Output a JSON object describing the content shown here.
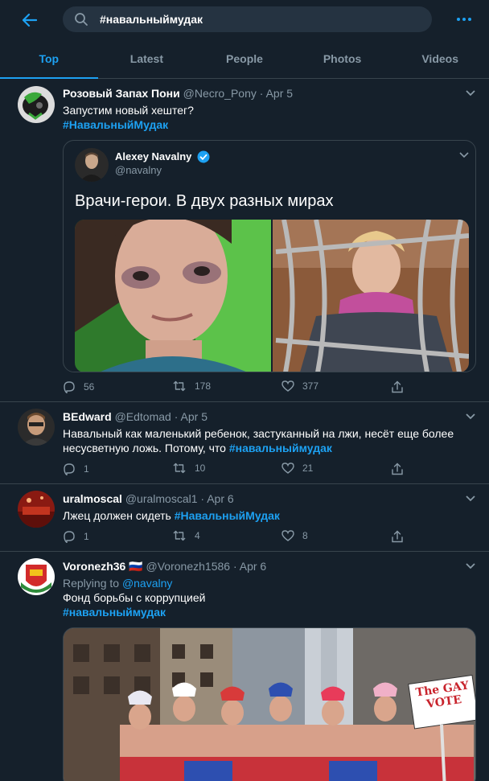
{
  "search": {
    "query": "#навальныймудак"
  },
  "tabs": [
    {
      "label": "Top",
      "active": true
    },
    {
      "label": "Latest",
      "active": false
    },
    {
      "label": "People",
      "active": false
    },
    {
      "label": "Photos",
      "active": false
    },
    {
      "label": "Videos",
      "active": false
    }
  ],
  "tweets": [
    {
      "name": "Розовый Запах Пони",
      "handle": "@Necro_Pony",
      "date": "Apr 5",
      "text_lines": [
        "Запустим новый хештег?"
      ],
      "hashtag": "#НавальныйМудак",
      "quote": {
        "name": "Alexey Navalny",
        "handle": "@navalny",
        "text": "Врачи-герои. В двух разных мирах"
      },
      "replies": "56",
      "retweets": "178",
      "likes": "377"
    },
    {
      "name": "BEdward",
      "handle": "@Edtomad",
      "date": "Apr 5",
      "line1": "Навальный как маленький ребенок, застуканный на лжи, несёт еще более",
      "line2_prefix": "несусветную ложь. Потому, что ",
      "hashtag": "#навальныймудак",
      "replies": "1",
      "retweets": "10",
      "likes": "21"
    },
    {
      "name": "uralmoscal",
      "handle": "@uralmoscal1",
      "date": "Apr 6",
      "text_prefix": "Лжец должен сидеть ",
      "hashtag": "#НавальныйМудак",
      "replies": "1",
      "retweets": "4",
      "likes": "8"
    },
    {
      "name": "Voronezh36",
      "flag": "🇷🇺",
      "handle": "@Voronezh1586",
      "date": "Apr 6",
      "replying_prefix": "Replying to ",
      "replying_handle": "@navalny",
      "text": "Фонд борьбы с коррупцией",
      "hashtag": "#навальныймудак",
      "media_sign": "The GAY VOTE"
    }
  ],
  "colors": {
    "background": "#15202b",
    "accent": "#1da1f2",
    "secondary_text": "#8899a6",
    "border": "#38444d"
  }
}
